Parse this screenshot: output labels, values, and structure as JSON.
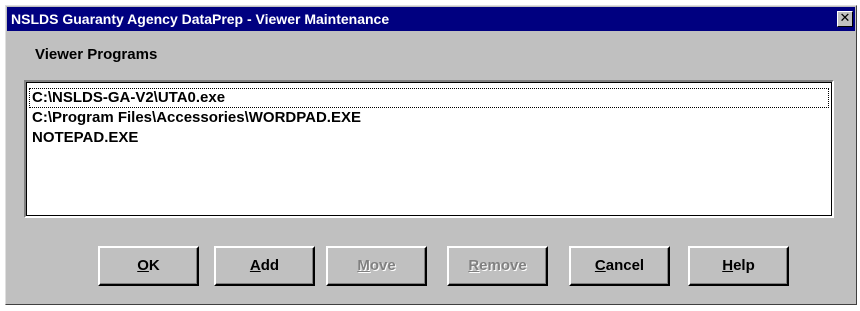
{
  "window": {
    "title": "NSLDS Guaranty Agency DataPrep - Viewer Maintenance",
    "close_glyph": "✕"
  },
  "group": {
    "label": "Viewer Programs"
  },
  "list": {
    "items": [
      "C:\\NSLDS-GA-V2\\UTA0.exe",
      "C:\\Program Files\\Accessories\\WORDPAD.EXE",
      "NOTEPAD.EXE"
    ]
  },
  "buttons": {
    "ok": {
      "mnemonic": "O",
      "rest": "K",
      "enabled": true
    },
    "add": {
      "mnemonic": "A",
      "rest": "dd",
      "enabled": true
    },
    "move": {
      "mnemonic": "M",
      "rest": "ove",
      "enabled": false
    },
    "remove": {
      "mnemonic": "R",
      "rest": "emove",
      "enabled": false
    },
    "cancel": {
      "mnemonic": "C",
      "rest": "ancel",
      "enabled": true
    },
    "help": {
      "mnemonic": "H",
      "rest": "elp",
      "enabled": true
    }
  },
  "colors": {
    "titlebar": "#000080",
    "face": "#c0c0c0",
    "disabled_text": "#808080"
  }
}
